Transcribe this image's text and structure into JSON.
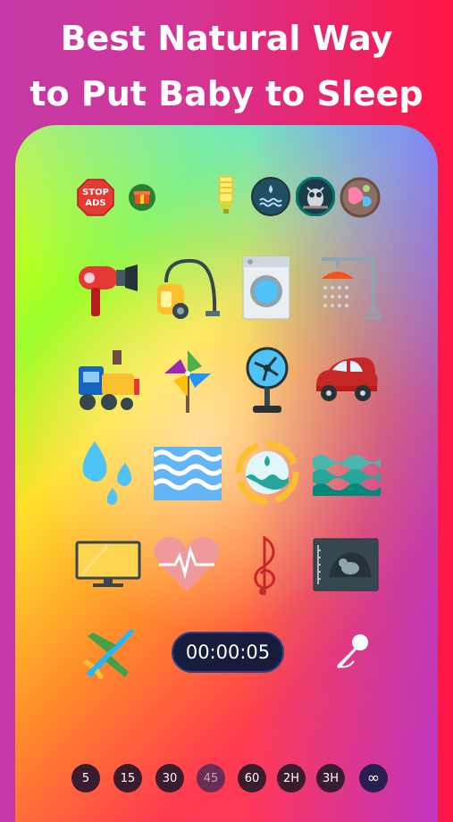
{
  "headline": {
    "line1": "Best Natural Way",
    "line2": "to Put Baby to Sleep"
  },
  "top_row": {
    "stop_ads_badge": {
      "line1": "STOP",
      "line2": "ADS"
    },
    "icons": [
      "stop-ads-icon",
      "gift-icon",
      "light-bulb-icon",
      "water-drops-icon",
      "owl-icon",
      "earth-icon"
    ]
  },
  "sound_grid": [
    [
      "hair-dryer-icon",
      "vacuum-cleaner-icon",
      "washing-machine-icon",
      "shower-icon"
    ],
    [
      "train-icon",
      "pinwheel-icon",
      "fan-icon",
      "car-icon"
    ],
    [
      "rain-drops-icon",
      "waves-icon",
      "water-cycle-icon",
      "sea-waves-icon"
    ],
    [
      "tv-icon",
      "heartbeat-icon",
      "music-note-icon",
      "ultrasound-icon"
    ]
  ],
  "bottom_controls": {
    "airplane": "airplane-icon",
    "timer": "00:00:05",
    "mic": "microphone-icon"
  },
  "timer_chips": [
    {
      "label": "5",
      "state": "normal"
    },
    {
      "label": "15",
      "state": "normal"
    },
    {
      "label": "30",
      "state": "normal"
    },
    {
      "label": "45",
      "state": "dim"
    },
    {
      "label": "60",
      "state": "normal"
    },
    {
      "label": "2H",
      "state": "normal"
    },
    {
      "label": "3H",
      "state": "normal"
    },
    {
      "label": "∞",
      "state": "selected"
    }
  ],
  "colors": {
    "timer_bg": "#171c3d",
    "chip_bg": "#3a1c2e",
    "headline": "#ffffff"
  }
}
